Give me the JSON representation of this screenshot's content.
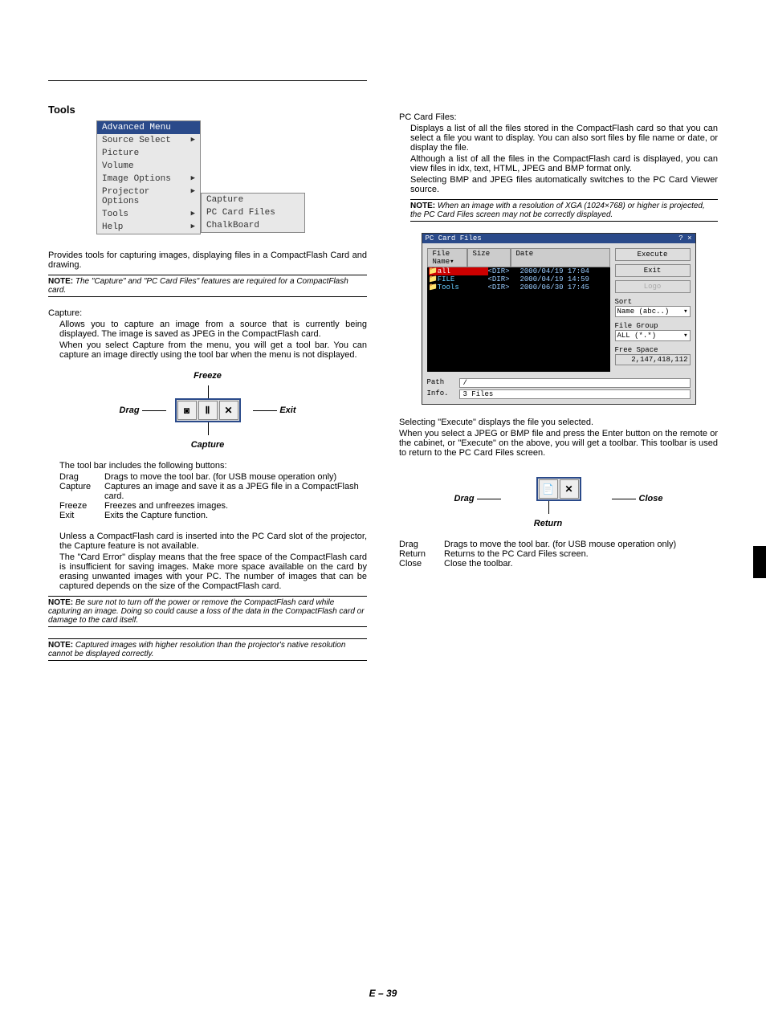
{
  "leftCol": {
    "heading": "Tools",
    "menu": {
      "title": "Advanced Menu",
      "items": [
        {
          "label": "Source Select",
          "arrow": true
        },
        {
          "label": "Picture",
          "arrow": false
        },
        {
          "label": "Volume",
          "arrow": false
        },
        {
          "label": "Image Options",
          "arrow": true
        },
        {
          "label": "Projector Options",
          "arrow": true
        },
        {
          "label": "Tools",
          "arrow": true
        },
        {
          "label": "Help",
          "arrow": true
        }
      ],
      "sub": [
        "Capture",
        "PC Card Files",
        "ChalkBoard"
      ]
    },
    "intro": "Provides tools for capturing images, displaying files in a CompactFlash Card and drawing.",
    "note1": "The \"Capture\" and \"PC Card Files\" features are required for a CompactFlash card.",
    "capture_head": "Capture:",
    "capture_p1": "Allows you to capture an image from a source that is currently being displayed. The image is saved as JPEG in the CompactFlash card.",
    "capture_p2": "When you select Capture from the menu, you will get a tool bar. You can capture an image directly using the tool bar when the menu is not displayed.",
    "fig1": {
      "freeze": "Freeze",
      "drag": "Drag",
      "exit": "Exit",
      "capture": "Capture"
    },
    "toolbar_intro": "The tool bar includes the following buttons:",
    "defs": [
      {
        "key": "Drag",
        "dots": ".............",
        "val": "Drags to move the tool bar. (for USB mouse operation only)"
      },
      {
        "key": "Capture",
        "dots": "........",
        "val": "Captures an image and save it as a JPEG file in a CompactFlash card."
      },
      {
        "key": "Freeze",
        "dots": "..........",
        "val": "Freezes and unfreezes images."
      },
      {
        "key": "Exit",
        "dots": "...............",
        "val": "Exits the Capture function."
      }
    ],
    "p3": "Unless a CompactFlash card is inserted into the PC Card slot of the projector, the Capture feature is not available.",
    "p4": "The \"Card Error\" display means that the free space of the CompactFlash card is insufficient for saving images. Make more space available on the card by erasing unwanted images with your PC. The number of images that can be captured depends on the size of the CompactFlash card.",
    "note2": "Be sure not to turn off the power or remove the CompactFlash card while capturing an image. Doing so could cause a loss of the data in the CompactFlash card or damage to the card itself.",
    "note3": "Captured images with higher resolution than the projector's native resolution cannot be displayed correctly."
  },
  "rightCol": {
    "pc_head": "PC Card Files:",
    "pc_p1": "Displays a list of all the files stored in the CompactFlash card so that you can select a file you want to display. You can also sort files by file name or date, or display the file.",
    "pc_p2": "Although a list of all the files in the CompactFlash card is displayed, you can view files in idx, text, HTML, JPEG and BMP format only.",
    "pc_p3": "Selecting BMP and JPEG files automatically switches to the PC Card Viewer source.",
    "note4": "When an image with a resolution of XGA (1024×768) or higher is projected, the PC Card Files screen may not be correctly displayed.",
    "dialog": {
      "title": "PC Card Files",
      "close": "? ×",
      "headers": {
        "name": "File Name▾",
        "size": "Size",
        "date": "Date"
      },
      "rows": [
        {
          "name": "all",
          "sel": true,
          "size": "<DIR>",
          "date": "2000/04/19 17:04"
        },
        {
          "name": "FILE",
          "sel": false,
          "size": "<DIR>",
          "date": "2000/04/19 14:59"
        },
        {
          "name": "Tools",
          "sel": false,
          "size": "<DIR>",
          "date": "2000/06/30 17:45"
        }
      ],
      "btn_exec": "Execute",
      "btn_exit": "Exit",
      "btn_logo": "Logo",
      "sort_label": "Sort",
      "sort_val": "Name (abc..)",
      "group_label": "File Group",
      "group_val": "ALL (*.*)",
      "free_label": "Free Space",
      "free_val": "2,147,418,112",
      "path_label": "Path",
      "path_val": "/",
      "info_label": "Info.",
      "info_val": "3 Files"
    },
    "p_sel": "Selecting \"Execute\" displays the file you selected.",
    "p_jpeg": "When you select a JPEG or BMP file and press the Enter button on the remote or the cabinet, or \"Execute\" on the above, you will get a toolbar. This toolbar is used to return to the PC Card Files screen.",
    "fig2": {
      "drag": "Drag",
      "close": "Close",
      "return": "Return"
    },
    "defs2": [
      {
        "key": "Drag",
        "dots": ".............",
        "val": "Drags to move the tool bar. (for USB mouse operation only)"
      },
      {
        "key": "Return",
        "dots": "..........",
        "val": "Returns to the PC Card Files screen."
      },
      {
        "key": "Close",
        "dots": "............",
        "val": "Close the toolbar."
      }
    ]
  },
  "pageNum": "E – 39"
}
